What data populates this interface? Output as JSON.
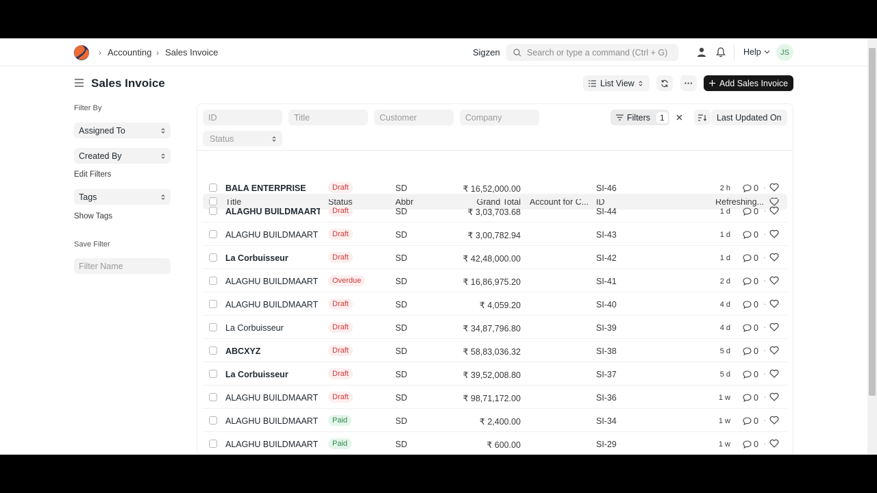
{
  "nav": {
    "breadcrumbs": [
      "Accounting",
      "Sales Invoice"
    ],
    "company": "Sigzen",
    "search_placeholder": "Search or type a command (Ctrl + G)",
    "help": "Help",
    "avatar_initials": "JS"
  },
  "page": {
    "title": "Sales Invoice",
    "list_view": "List View",
    "more": "···",
    "add_button": "Add Sales Invoice"
  },
  "sidebar": {
    "filter_by": "Filter By",
    "assigned_to": "Assigned To",
    "created_by": "Created By",
    "edit_filters": "Edit Filters",
    "tags": "Tags",
    "show_tags": "Show Tags",
    "save_filter": "Save Filter",
    "filter_name_placeholder": "Filter Name"
  },
  "filters": {
    "id_placeholder": "ID",
    "title_placeholder": "Title",
    "customer_placeholder": "Customer",
    "company_placeholder": "Company",
    "status": "Status",
    "filters_label": "Filters",
    "filters_count": "1",
    "sort_label": "Last Updated On"
  },
  "table": {
    "headers": {
      "title": "Title",
      "status": "Status",
      "abbr": "Abbr",
      "grand_total": "Grand Total",
      "account": "Account for C...",
      "id": "ID",
      "refreshing": "Refreshing..."
    },
    "rows": [
      {
        "title": "BALA ENTERPRISE",
        "bold": true,
        "status": "Draft",
        "abbr": "SD",
        "total": "₹ 16,52,000.00",
        "id": "SI-46",
        "ago": "2 h",
        "comments": "0"
      },
      {
        "title": "ALAGHU BUILDMAART PVT LTD",
        "bold": true,
        "status": "Draft",
        "abbr": "SD",
        "total": "₹ 3,03,703.68",
        "id": "SI-44",
        "ago": "1 d",
        "comments": "0"
      },
      {
        "title": "ALAGHU BUILDMAART PVT LTD",
        "bold": false,
        "status": "Draft",
        "abbr": "SD",
        "total": "₹ 3,00,782.94",
        "id": "SI-43",
        "ago": "1 d",
        "comments": "0"
      },
      {
        "title": "La Corbuisseur",
        "bold": true,
        "status": "Draft",
        "abbr": "SD",
        "total": "₹ 42,48,000.00",
        "id": "SI-42",
        "ago": "1 d",
        "comments": "0"
      },
      {
        "title": "ALAGHU BUILDMAART PVT LTD",
        "bold": false,
        "status": "Overdue",
        "abbr": "SD",
        "total": "₹ 16,86,975.20",
        "id": "SI-41",
        "ago": "2 d",
        "comments": "0"
      },
      {
        "title": "ALAGHU BUILDMAART PVT LTD",
        "bold": false,
        "status": "Draft",
        "abbr": "SD",
        "total": "₹ 4,059.20",
        "id": "SI-40",
        "ago": "4 d",
        "comments": "0"
      },
      {
        "title": "La Corbuisseur",
        "bold": false,
        "status": "Draft",
        "abbr": "SD",
        "total": "₹ 34,87,796.80",
        "id": "SI-39",
        "ago": "4 d",
        "comments": "0"
      },
      {
        "title": "ABCXYZ",
        "bold": true,
        "status": "Draft",
        "abbr": "SD",
        "total": "₹ 58,83,036.32",
        "id": "SI-38",
        "ago": "5 d",
        "comments": "0"
      },
      {
        "title": "La Corbuisseur",
        "bold": true,
        "status": "Draft",
        "abbr": "SD",
        "total": "₹ 39,52,008.80",
        "id": "SI-37",
        "ago": "5 d",
        "comments": "0"
      },
      {
        "title": "ALAGHU BUILDMAART PVT LTD",
        "bold": false,
        "status": "Draft",
        "abbr": "SD",
        "total": "₹ 98,71,172.00",
        "id": "SI-36",
        "ago": "1 w",
        "comments": "0"
      },
      {
        "title": "ALAGHU BUILDMAART PVT LTD",
        "bold": false,
        "status": "Paid",
        "abbr": "SD",
        "total": "₹ 2,400.00",
        "id": "SI-34",
        "ago": "1 w",
        "comments": "0"
      },
      {
        "title": "ALAGHU BUILDMAART PVT LTD",
        "bold": false,
        "status": "Paid",
        "abbr": "SD",
        "total": "₹ 600.00",
        "id": "SI-29",
        "ago": "1 w",
        "comments": "0"
      }
    ]
  },
  "colors": {
    "draft": "#cc3a3a",
    "overdue": "#cc3a3a",
    "paid": "#2f8a4e",
    "primary_button": "#171717",
    "logo_orange": "#f06a35",
    "logo_blue": "#2c3a5c"
  },
  "icons": [
    "logo-icon",
    "chevron-right-icon",
    "search-icon",
    "user-icon",
    "bell-icon",
    "chevron-down-icon",
    "hamburger-icon",
    "list-icon",
    "refresh-icon",
    "plus-icon",
    "filter-icon",
    "close-icon",
    "sort-icon",
    "comment-icon",
    "heart-icon"
  ]
}
